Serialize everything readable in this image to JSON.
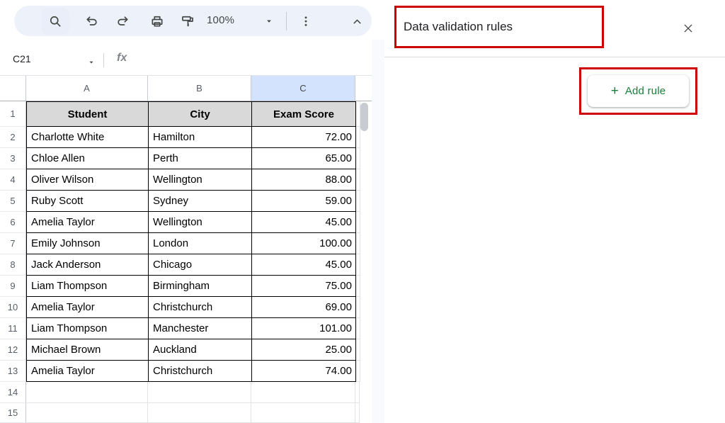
{
  "toolbar": {
    "zoom_label": "100%",
    "icons": [
      "search",
      "undo",
      "redo",
      "print",
      "paint-format",
      "zoom-dropdown",
      "more-options",
      "collapse-toolbar"
    ]
  },
  "formula_bar": {
    "name_box_value": "C21",
    "fx_label": "fx"
  },
  "sheet": {
    "column_letters": {
      "a": "A",
      "b": "B",
      "c": "C"
    },
    "selected_column": "C",
    "header_row_number": "1",
    "header_cells": [
      "Student",
      "City",
      "Exam Score"
    ],
    "rows": [
      {
        "n": "2",
        "cells": [
          "Charlotte White",
          "Hamilton",
          "72.00"
        ]
      },
      {
        "n": "3",
        "cells": [
          "Chloe Allen",
          "Perth",
          "65.00"
        ]
      },
      {
        "n": "4",
        "cells": [
          "Oliver Wilson",
          "Wellington",
          "88.00"
        ]
      },
      {
        "n": "5",
        "cells": [
          "Ruby Scott",
          "Sydney",
          "59.00"
        ]
      },
      {
        "n": "6",
        "cells": [
          "Amelia Taylor",
          "Wellington",
          "45.00"
        ]
      },
      {
        "n": "7",
        "cells": [
          "Emily Johnson",
          "London",
          "100.00"
        ]
      },
      {
        "n": "8",
        "cells": [
          "Jack Anderson",
          "Chicago",
          "45.00"
        ]
      },
      {
        "n": "9",
        "cells": [
          "Liam Thompson",
          "Birmingham",
          "75.00"
        ]
      },
      {
        "n": "10",
        "cells": [
          "Amelia Taylor",
          "Christchurch",
          "69.00"
        ]
      },
      {
        "n": "11",
        "cells": [
          "Liam Thompson",
          "Manchester",
          "101.00"
        ]
      },
      {
        "n": "12",
        "cells": [
          "Michael Brown",
          "Auckland",
          "25.00"
        ]
      },
      {
        "n": "13",
        "cells": [
          "Amelia Taylor",
          "Christchurch",
          "74.00"
        ]
      }
    ],
    "empty_rows": [
      "14",
      "15"
    ]
  },
  "panel": {
    "title": "Data validation rules",
    "add_rule": {
      "plus": "+",
      "label": "Add rule"
    }
  },
  "colors": {
    "accent_green": "#188038",
    "annotation_red": "#cc0000",
    "selected_column_header": "#d3e3fd",
    "table_header_gray": "#d9d9d9",
    "toolbar_bg": "#edf2fa"
  }
}
